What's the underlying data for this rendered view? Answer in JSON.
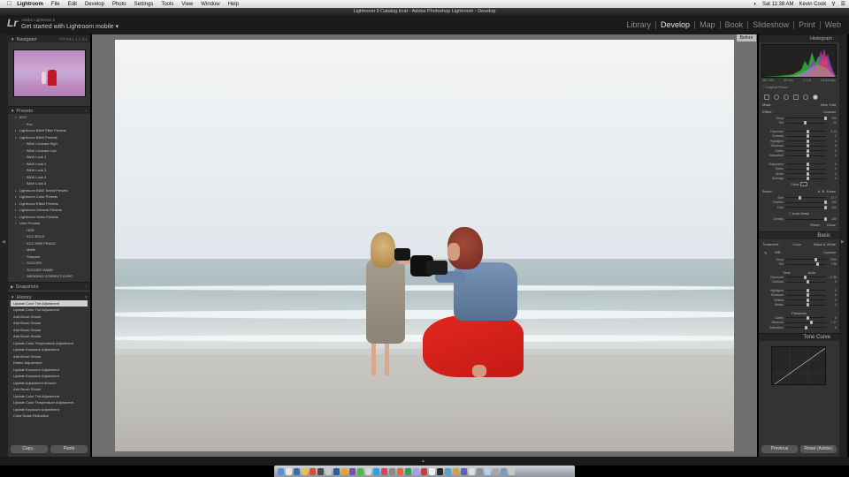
{
  "menubar": {
    "items": [
      "Lightroom",
      "File",
      "Edit",
      "Develop",
      "Photo",
      "Settings",
      "Tools",
      "View",
      "Window",
      "Help"
    ],
    "time": "Sat 11:38 AM",
    "user": "Kevin Cook"
  },
  "window_title": "Lightroom 5 Catalog.lrcat - Adobe Photoshop Lightroom - Develop",
  "identity": {
    "logo": "Lr",
    "product": "Adobe Lightroom 5",
    "tagline": "Get started with Lightroom mobile ▾"
  },
  "modules": [
    "Library",
    "Develop",
    "Map",
    "Book",
    "Slideshow",
    "Print",
    "Web"
  ],
  "active_module": "Develop",
  "left": {
    "navigator": {
      "title": "Navigator",
      "zoom": "FIT  FILL  1:1  3:1"
    },
    "presets": {
      "title": "Presets",
      "items": [
        {
          "icon": "▾",
          "label": "KCC",
          "indent": 1
        },
        {
          "icon": "□",
          "label": "Kcc",
          "indent": 2
        },
        {
          "icon": "▸",
          "label": "Lightroom B&W Filter Presets",
          "indent": 1
        },
        {
          "icon": "▾",
          "label": "Lightroom B&W Presets",
          "indent": 1
        },
        {
          "icon": "□",
          "label": "B&W Contrast High",
          "indent": 2
        },
        {
          "icon": "□",
          "label": "B&W Contrast Low",
          "indent": 2
        },
        {
          "icon": "□",
          "label": "B&W Look 1",
          "indent": 2
        },
        {
          "icon": "□",
          "label": "B&W Look 2",
          "indent": 2
        },
        {
          "icon": "□",
          "label": "B&W Look 3",
          "indent": 2
        },
        {
          "icon": "□",
          "label": "B&W Look 4",
          "indent": 2
        },
        {
          "icon": "□",
          "label": "B&W Look 5",
          "indent": 2
        },
        {
          "icon": "▸",
          "label": "Lightroom B&W Toned Presets",
          "indent": 1
        },
        {
          "icon": "▸",
          "label": "Lightroom Color Presets",
          "indent": 1
        },
        {
          "icon": "▸",
          "label": "Lightroom Effect Presets",
          "indent": 1
        },
        {
          "icon": "▸",
          "label": "Lightroom General Presets",
          "indent": 1
        },
        {
          "icon": "▸",
          "label": "Lightroom Video Presets",
          "indent": 1
        },
        {
          "icon": "▾",
          "label": "User Presets",
          "indent": 1
        },
        {
          "icon": "□",
          "label": "HDR",
          "indent": 2
        },
        {
          "icon": "□",
          "label": "KCC BOLD",
          "indent": 2
        },
        {
          "icon": "□",
          "label": "KCC HDR FRAUD",
          "indent": 2
        },
        {
          "icon": "□",
          "label": "Matte",
          "indent": 2
        },
        {
          "icon": "□",
          "label": "Sharpen",
          "indent": 2
        },
        {
          "icon": "□",
          "label": "SOCCER",
          "indent": 2
        },
        {
          "icon": "□",
          "label": "SOCCER GAME",
          "indent": 2
        },
        {
          "icon": "□",
          "label": "WEDDING CORRECT EXPO",
          "indent": 2
        }
      ]
    },
    "snapshots": {
      "title": "Snapshots"
    },
    "history": {
      "title": "History",
      "items": [
        "Update Color Tint Adjustment",
        "Update Color Tint Adjustment",
        "Add Brush Stroke",
        "Add Brush Stroke",
        "Add Brush Stroke",
        "Add Brush Stroke",
        "Update Color Temperature Adjustment",
        "Update Exposure Adjustment",
        "Add Brush Stroke",
        "Delete Adjustment",
        "Update Exposure Adjustment",
        "Update Exposure Adjustment",
        "Update Adjustment Amount",
        "Add Brush Stroke",
        "Update Color Tint Adjustment",
        "Update Color Temperature Adjustment",
        "Update Exposure Adjustment",
        "Color Noise Reduction"
      ]
    },
    "copy_label": "Copy...",
    "paste_label": "Paste"
  },
  "before_label": "Before",
  "right": {
    "histogram_title": "Histogram",
    "hist_info": [
      "ISO 100",
      "35 mm",
      "f / 2.8",
      "1/1000 sec"
    ],
    "original_photo": "Original Photo",
    "mask": {
      "label": "Mask :",
      "new": "New",
      "edit": "Edit"
    },
    "effect": {
      "label": "Effect :",
      "value": "Custom"
    },
    "brush_sliders": [
      {
        "label": "Temp",
        "val": "100",
        "pos": 0.95
      },
      {
        "label": "Tint",
        "val": "- 12",
        "pos": 0.45
      },
      {
        "label": "",
        "val": "",
        "pos": -1
      },
      {
        "label": "Exposure",
        "val": "0.13",
        "pos": 0.52
      },
      {
        "label": "Contrast",
        "val": "0",
        "pos": 0.5
      },
      {
        "label": "Highlights",
        "val": "0",
        "pos": 0.5
      },
      {
        "label": "Shadows",
        "val": "0",
        "pos": 0.5
      },
      {
        "label": "Clarity",
        "val": "0",
        "pos": 0.5
      },
      {
        "label": "Saturation",
        "val": "0",
        "pos": 0.5
      },
      {
        "label": "",
        "val": "",
        "pos": -1
      },
      {
        "label": "Sharpness",
        "val": "0",
        "pos": 0.5
      },
      {
        "label": "Noise",
        "val": "0",
        "pos": 0.5
      },
      {
        "label": "Moire",
        "val": "0",
        "pos": 0.5
      },
      {
        "label": "Defringe",
        "val": "0",
        "pos": 0.5
      }
    ],
    "color_label": "Color",
    "brush": {
      "label": "Brush :",
      "a": "A",
      "b": "B",
      "erase": "Erase"
    },
    "brush_size": [
      {
        "label": "Size",
        "val": "17.7",
        "pos": 0.3
      },
      {
        "label": "Feather",
        "val": "100",
        "pos": 0.95
      },
      {
        "label": "Flow",
        "val": "100",
        "pos": 0.95
      }
    ],
    "automask": "Auto Mask",
    "density": {
      "label": "Density",
      "val": "100",
      "pos": 0.95
    },
    "reset": "Reset",
    "close": "Close",
    "basic_title": "Basic",
    "treatment": {
      "label": "Treatment :",
      "color": "Color",
      "bw": "Black & White"
    },
    "wb": {
      "label": "WB :",
      "value": "Custom"
    },
    "wb_sliders": [
      {
        "label": "Temp",
        "val": "7300",
        "pos": 0.7
      },
      {
        "label": "Tint",
        "val": "+ 58",
        "pos": 0.75
      }
    ],
    "tone": {
      "label": "Tone",
      "auto": "Auto"
    },
    "tone_sliders": [
      {
        "label": "Exposure",
        "val": "- 0.35",
        "pos": 0.45
      },
      {
        "label": "Contrast",
        "val": "0",
        "pos": 0.5
      },
      {
        "label": "",
        "val": "",
        "pos": -1
      },
      {
        "label": "Highlights",
        "val": "0",
        "pos": 0.5
      },
      {
        "label": "Shadows",
        "val": "0",
        "pos": 0.5
      },
      {
        "label": "Whites",
        "val": "0",
        "pos": 0.5
      },
      {
        "label": "Blacks",
        "val": "0",
        "pos": 0.5
      }
    ],
    "presence_label": "Presence",
    "presence_sliders": [
      {
        "label": "Clarity",
        "val": "0",
        "pos": 0.5
      },
      {
        "label": "Vibrance",
        "val": "+ 17",
        "pos": 0.6
      },
      {
        "label": "Saturation",
        "val": "- 6",
        "pos": 0.47
      }
    ],
    "tonecurve_title": "Tone Curve",
    "previous": "Previous",
    "reset_adobe": "Reset (Adobe)"
  },
  "colors": {
    "accent_module": "#e6e6e6",
    "panel_bg": "#333333",
    "history_selected": "#cfcfcf"
  }
}
